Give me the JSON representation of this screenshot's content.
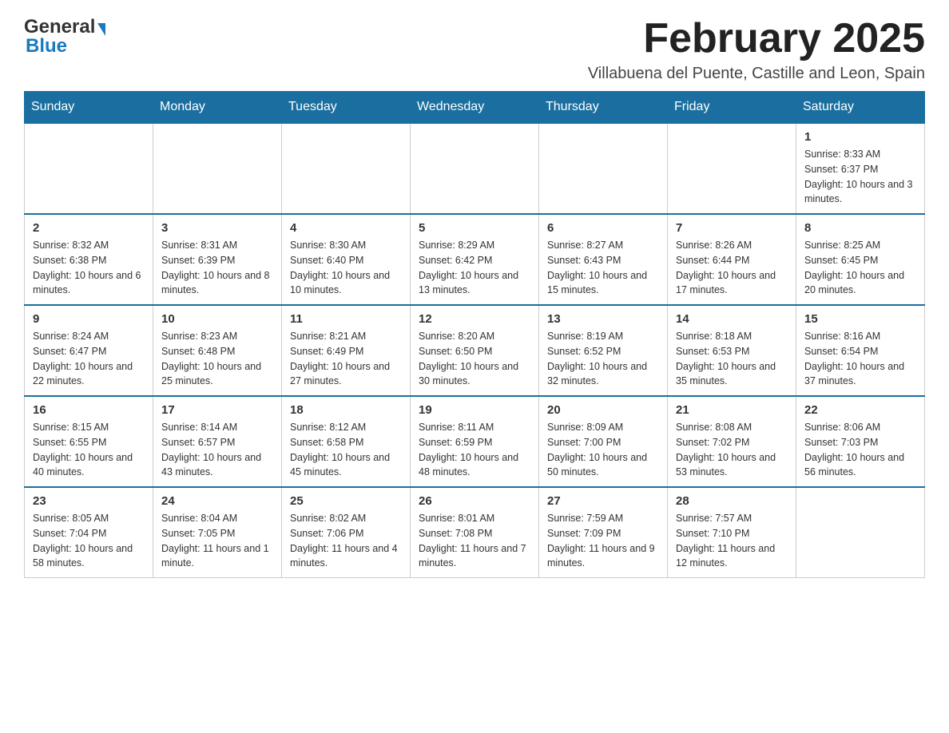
{
  "header": {
    "logo_general": "General",
    "logo_blue": "Blue",
    "month_title": "February 2025",
    "location": "Villabuena del Puente, Castille and Leon, Spain"
  },
  "days_of_week": [
    "Sunday",
    "Monday",
    "Tuesday",
    "Wednesday",
    "Thursday",
    "Friday",
    "Saturday"
  ],
  "weeks": [
    {
      "days": [
        {
          "num": "",
          "info": ""
        },
        {
          "num": "",
          "info": ""
        },
        {
          "num": "",
          "info": ""
        },
        {
          "num": "",
          "info": ""
        },
        {
          "num": "",
          "info": ""
        },
        {
          "num": "",
          "info": ""
        },
        {
          "num": "1",
          "info": "Sunrise: 8:33 AM\nSunset: 6:37 PM\nDaylight: 10 hours and 3 minutes."
        }
      ]
    },
    {
      "days": [
        {
          "num": "2",
          "info": "Sunrise: 8:32 AM\nSunset: 6:38 PM\nDaylight: 10 hours and 6 minutes."
        },
        {
          "num": "3",
          "info": "Sunrise: 8:31 AM\nSunset: 6:39 PM\nDaylight: 10 hours and 8 minutes."
        },
        {
          "num": "4",
          "info": "Sunrise: 8:30 AM\nSunset: 6:40 PM\nDaylight: 10 hours and 10 minutes."
        },
        {
          "num": "5",
          "info": "Sunrise: 8:29 AM\nSunset: 6:42 PM\nDaylight: 10 hours and 13 minutes."
        },
        {
          "num": "6",
          "info": "Sunrise: 8:27 AM\nSunset: 6:43 PM\nDaylight: 10 hours and 15 minutes."
        },
        {
          "num": "7",
          "info": "Sunrise: 8:26 AM\nSunset: 6:44 PM\nDaylight: 10 hours and 17 minutes."
        },
        {
          "num": "8",
          "info": "Sunrise: 8:25 AM\nSunset: 6:45 PM\nDaylight: 10 hours and 20 minutes."
        }
      ]
    },
    {
      "days": [
        {
          "num": "9",
          "info": "Sunrise: 8:24 AM\nSunset: 6:47 PM\nDaylight: 10 hours and 22 minutes."
        },
        {
          "num": "10",
          "info": "Sunrise: 8:23 AM\nSunset: 6:48 PM\nDaylight: 10 hours and 25 minutes."
        },
        {
          "num": "11",
          "info": "Sunrise: 8:21 AM\nSunset: 6:49 PM\nDaylight: 10 hours and 27 minutes."
        },
        {
          "num": "12",
          "info": "Sunrise: 8:20 AM\nSunset: 6:50 PM\nDaylight: 10 hours and 30 minutes."
        },
        {
          "num": "13",
          "info": "Sunrise: 8:19 AM\nSunset: 6:52 PM\nDaylight: 10 hours and 32 minutes."
        },
        {
          "num": "14",
          "info": "Sunrise: 8:18 AM\nSunset: 6:53 PM\nDaylight: 10 hours and 35 minutes."
        },
        {
          "num": "15",
          "info": "Sunrise: 8:16 AM\nSunset: 6:54 PM\nDaylight: 10 hours and 37 minutes."
        }
      ]
    },
    {
      "days": [
        {
          "num": "16",
          "info": "Sunrise: 8:15 AM\nSunset: 6:55 PM\nDaylight: 10 hours and 40 minutes."
        },
        {
          "num": "17",
          "info": "Sunrise: 8:14 AM\nSunset: 6:57 PM\nDaylight: 10 hours and 43 minutes."
        },
        {
          "num": "18",
          "info": "Sunrise: 8:12 AM\nSunset: 6:58 PM\nDaylight: 10 hours and 45 minutes."
        },
        {
          "num": "19",
          "info": "Sunrise: 8:11 AM\nSunset: 6:59 PM\nDaylight: 10 hours and 48 minutes."
        },
        {
          "num": "20",
          "info": "Sunrise: 8:09 AM\nSunset: 7:00 PM\nDaylight: 10 hours and 50 minutes."
        },
        {
          "num": "21",
          "info": "Sunrise: 8:08 AM\nSunset: 7:02 PM\nDaylight: 10 hours and 53 minutes."
        },
        {
          "num": "22",
          "info": "Sunrise: 8:06 AM\nSunset: 7:03 PM\nDaylight: 10 hours and 56 minutes."
        }
      ]
    },
    {
      "days": [
        {
          "num": "23",
          "info": "Sunrise: 8:05 AM\nSunset: 7:04 PM\nDaylight: 10 hours and 58 minutes."
        },
        {
          "num": "24",
          "info": "Sunrise: 8:04 AM\nSunset: 7:05 PM\nDaylight: 11 hours and 1 minute."
        },
        {
          "num": "25",
          "info": "Sunrise: 8:02 AM\nSunset: 7:06 PM\nDaylight: 11 hours and 4 minutes."
        },
        {
          "num": "26",
          "info": "Sunrise: 8:01 AM\nSunset: 7:08 PM\nDaylight: 11 hours and 7 minutes."
        },
        {
          "num": "27",
          "info": "Sunrise: 7:59 AM\nSunset: 7:09 PM\nDaylight: 11 hours and 9 minutes."
        },
        {
          "num": "28",
          "info": "Sunrise: 7:57 AM\nSunset: 7:10 PM\nDaylight: 11 hours and 12 minutes."
        },
        {
          "num": "",
          "info": ""
        }
      ]
    }
  ]
}
